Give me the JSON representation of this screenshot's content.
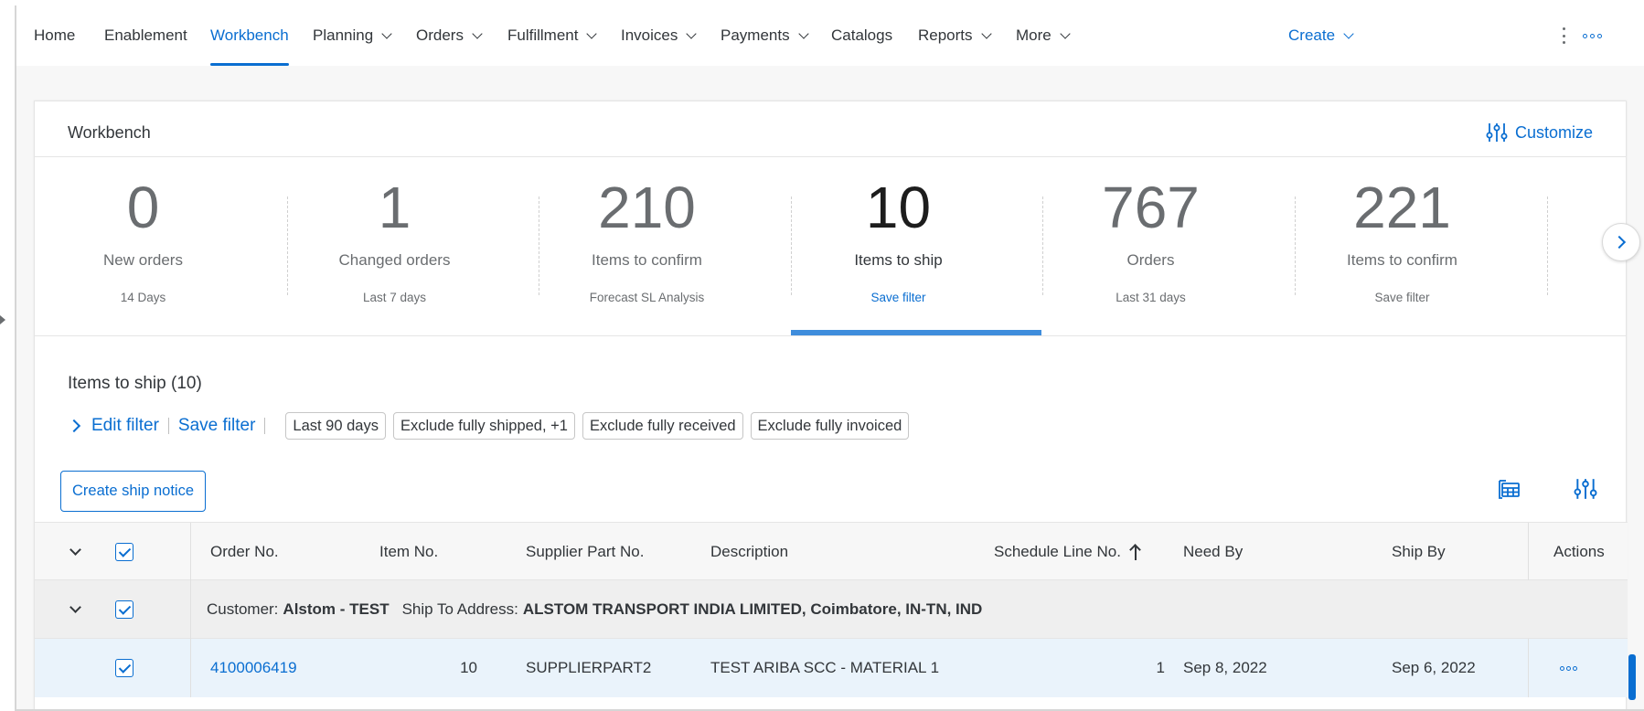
{
  "nav": {
    "items": [
      {
        "label": "Home",
        "dropdown": false
      },
      {
        "label": "Enablement",
        "dropdown": false
      },
      {
        "label": "Workbench",
        "dropdown": false,
        "active": true
      },
      {
        "label": "Planning",
        "dropdown": true
      },
      {
        "label": "Orders",
        "dropdown": true
      },
      {
        "label": "Fulfillment",
        "dropdown": true
      },
      {
        "label": "Invoices",
        "dropdown": true
      },
      {
        "label": "Payments",
        "dropdown": true
      },
      {
        "label": "Catalogs",
        "dropdown": false
      },
      {
        "label": "Reports",
        "dropdown": true
      },
      {
        "label": "More",
        "dropdown": true
      }
    ],
    "create_label": "Create",
    "accent": "#0a6ed1"
  },
  "workbench": {
    "title": "Workbench",
    "customize_label": "Customize",
    "tiles": [
      {
        "count": "0",
        "label": "New orders",
        "sub": "14 Days"
      },
      {
        "count": "1",
        "label": "Changed orders",
        "sub": "Last 7 days"
      },
      {
        "count": "210",
        "label": "Items to confirm",
        "sub": "Forecast SL Analysis"
      },
      {
        "count": "10",
        "label": "Items to ship",
        "sub": "Save filter",
        "active": true
      },
      {
        "count": "767",
        "label": "Orders",
        "sub": "Last 31 days"
      },
      {
        "count": "221",
        "label": "Items to confirm",
        "sub": "Save filter"
      }
    ]
  },
  "filter": {
    "title": "Items to ship (10)",
    "edit_filter": "Edit filter",
    "save_filter": "Save filter",
    "chips": [
      "Last 90 days",
      "Exclude fully shipped, +1",
      "Exclude fully received",
      "Exclude fully invoiced"
    ]
  },
  "actions": {
    "create_ship_notice": "Create ship notice"
  },
  "table": {
    "columns": {
      "order_no": "Order No.",
      "item_no": "Item No.",
      "supplier_part_no": "Supplier Part No.",
      "description": "Description",
      "schedule_line_no": "Schedule Line No.",
      "need_by": "Need By",
      "ship_by": "Ship By",
      "actions": "Actions"
    },
    "group": {
      "customer_label": "Customer:",
      "customer_value": "Alstom - TEST",
      "ship_to_label": "Ship To Address:",
      "ship_to_value": "ALSTOM TRANSPORT INDIA LIMITED, Coimbatore, IN-TN, IND"
    },
    "rows": [
      {
        "order_no": "4100006419",
        "item_no": "10",
        "supplier_part_no": "SUPPLIERPART2",
        "description": "TEST ARIBA SCC - MATERIAL 1",
        "schedule_line_no": "1",
        "need_by": "Sep 8, 2022",
        "ship_by": "Sep 6, 2022"
      }
    ]
  }
}
